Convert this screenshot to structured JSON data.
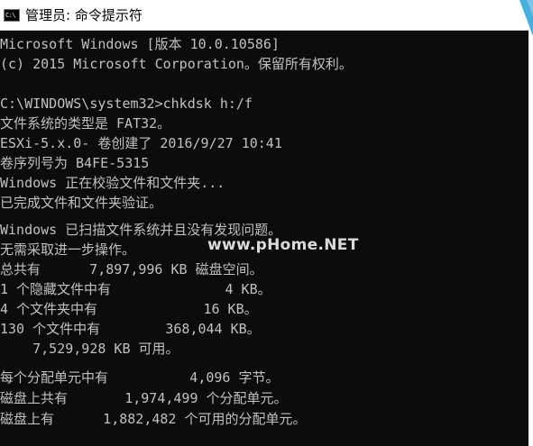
{
  "window": {
    "icon_label": "C:\\",
    "title": "管理员: 命令提示符"
  },
  "console": {
    "lines": [
      "Microsoft Windows [版本 10.0.10586]",
      "(c) 2015 Microsoft Corporation。保留所有权利。",
      "",
      "C:\\WINDOWS\\system32>chkdsk h:/f",
      "文件系统的类型是 FAT32。",
      "ESXi-5.x.0- 卷创建了 2016/9/27 10:41",
      "卷序列号为 B4FE-5315",
      "Windows 正在校验文件和文件夹...",
      "已完成文件和文件夹验证。",
      "",
      "Windows 已扫描文件系统并且没有发现问题。",
      "无需采取进一步操作。",
      "总共有      7,897,996 KB 磁盘空间。",
      "1 个隐藏文件中有              4 KB。",
      "4 个文件夹中有             16 KB。",
      "130 个文件中有        368,044 KB。",
      "    7,529,928 KB 可用。",
      "",
      "每个分配单元中有          4,096 字节。",
      "磁盘上共有       1,974,499 个分配单元。",
      "磁盘上有      1,882,482 个可用的分配单元。"
    ]
  },
  "watermark": "www.pHome.NET",
  "colors": {
    "console_bg": "#0c0c0c",
    "console_text": "#c0c0c0",
    "accent": "#2a9fd6"
  }
}
